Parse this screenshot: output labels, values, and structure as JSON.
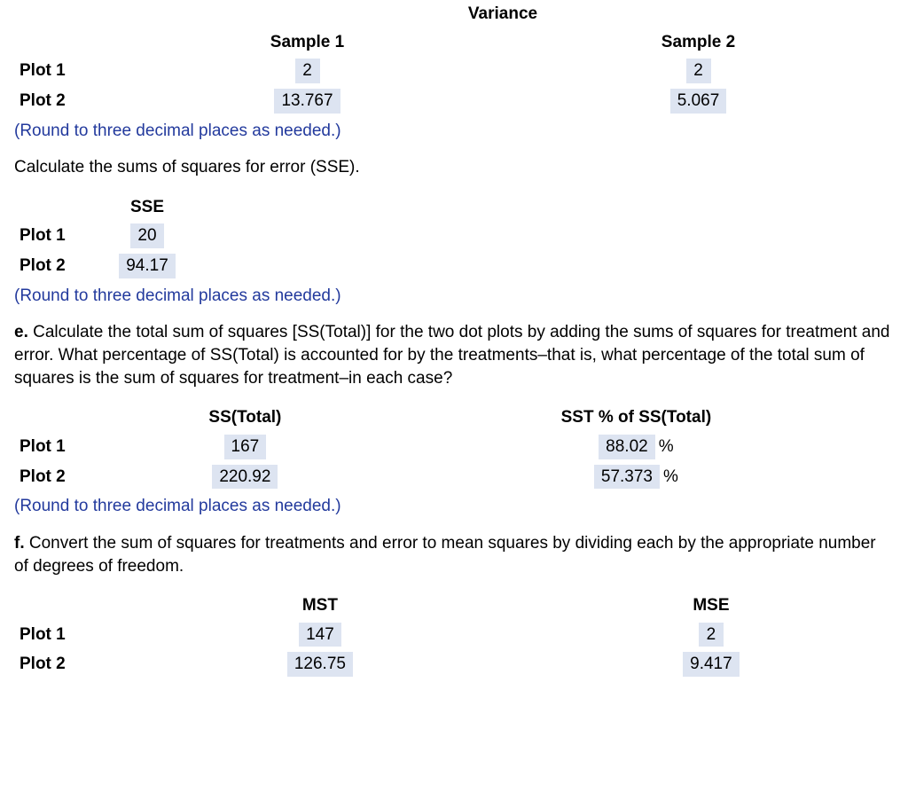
{
  "variance_table": {
    "super_header": "Variance",
    "headers": [
      "Sample 1",
      "Sample 2"
    ],
    "rows": {
      "plot1_label": "Plot 1",
      "plot1_s1": "2",
      "plot1_s2": "2",
      "plot2_label": "Plot 2",
      "plot2_s1": "13.767",
      "plot2_s2": "5.067"
    },
    "rounding": "(Round to three decimal places as needed.)"
  },
  "sse": {
    "prompt": "Calculate the sums of squares for error (SSE).",
    "header": "SSE",
    "plot1_label": "Plot 1",
    "plot1_val": "20",
    "plot2_label": "Plot 2",
    "plot2_val": "94.17",
    "rounding": "(Round to three decimal places as needed.)"
  },
  "part_e": {
    "prefix": "e.",
    "text": "Calculate the total sum of squares [SS(Total)] for the two dot plots by adding the sums of squares for treatment and error. What percentage of SS(Total) is accounted for by the treatments–that is, what percentage of the total sum of squares is the sum of squares for treatment–in each case?",
    "col1": "SS(Total)",
    "col2": "SST % of SS(Total)",
    "plot1_label": "Plot 1",
    "plot1_sstot": "167",
    "plot1_pct": "88.02",
    "plot2_label": "Plot 2",
    "plot2_sstot": "220.92",
    "plot2_pct": "57.373",
    "pct_symbol": "%",
    "rounding": "(Round to three decimal places as needed.)"
  },
  "part_f": {
    "prefix": "f.",
    "text": "Convert the sum of squares for treatments and error to mean squares by dividing each by the appropriate number of degrees of freedom.",
    "col1": "MST",
    "col2": "MSE",
    "plot1_label": "Plot 1",
    "plot1_mst": "147",
    "plot1_mse": "2",
    "plot2_label": "Plot 2",
    "plot2_mst": "126.75",
    "plot2_mse": "9.417"
  }
}
